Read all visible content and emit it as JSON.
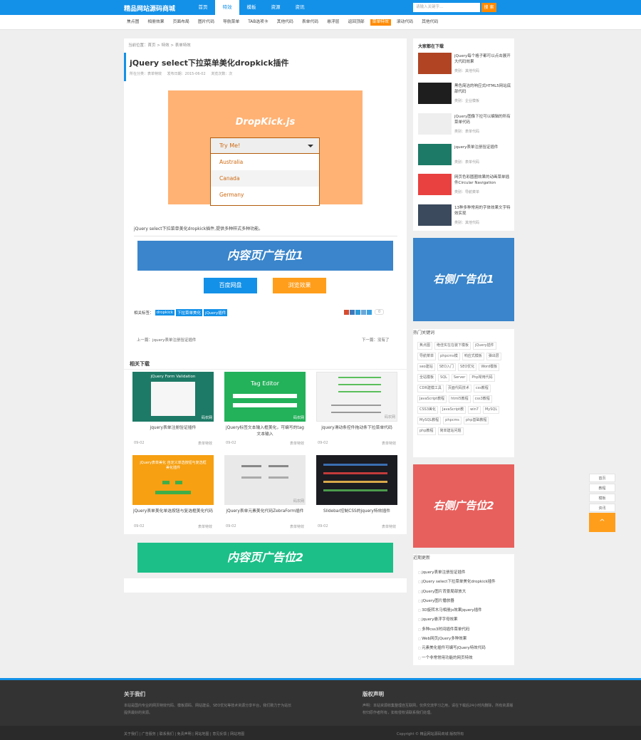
{
  "header": {
    "logo": "精品网站源码商城",
    "nav": [
      "首页",
      "特效",
      "模板",
      "资源",
      "资讯"
    ],
    "active_nav": 1,
    "search_placeholder": "请输入关键字...",
    "search_button": "搜 索",
    "brand_color": "#1391e8",
    "accent_color": "#ff8a00"
  },
  "subnav": [
    "焦点图",
    "相册效果",
    "页面布局",
    "图片代码",
    "导航菜单",
    "TAB选项卡",
    "其他代码",
    "表单代码",
    "悬浮层",
    "返回顶部",
    "菜单特效",
    "滚动代码",
    "其他代码"
  ],
  "subnav_hot_index": 10,
  "article": {
    "breadcrumb": "当前位置：首页 > 特效 > 表单特效",
    "title": "jQuery select下拉菜单美化dropkick插件",
    "meta_category": "所在分类：表单特效",
    "meta_date": "发布日期：2015-06-02",
    "meta_views": "浏览次数：次",
    "preview_title": "DropKick.js",
    "preview_select": "Try Me!",
    "preview_options": [
      "Australia",
      "Canada",
      "Germany"
    ],
    "intro": "jQuery select下拉菜单美化dropkick插件,提供多种样式多种功能。",
    "ad1": "内容页广告位1",
    "btn_pan": "百度网盘",
    "btn_demo": "浏览效果",
    "tags_label": "相关标签：",
    "tags": [
      "dropkick",
      "下拉菜单美化",
      "jQuery插件"
    ],
    "share_count": "0"
  },
  "prevnext": {
    "prev": "上一篇：jquery表单注册验证插件",
    "next": "下一篇：没有了"
  },
  "related": {
    "heading": "相关下载",
    "items": [
      {
        "title": "jquery表单注册验证插件",
        "date": "09-02",
        "cat": "表单特效",
        "thumb_label": "jQuery Form Validation",
        "color": "#1d7a66",
        "watermark": "码农网"
      },
      {
        "title": "jQuery标签文本输入框美化，可编写的tag文本输入",
        "date": "09-02",
        "cat": "表单特效",
        "thumb_label": "Tag Editor",
        "color": "#23b15a",
        "watermark": "码农网"
      },
      {
        "title": "jquery滑动条控件拖动条下拉菜单代码",
        "date": "09-02",
        "cat": "表单特效",
        "thumb_label": "",
        "color": "#f2f2f2",
        "watermark": "码农网"
      },
      {
        "title": "jQuery表单美化单选按钮与复选框美化代码",
        "date": "09-02",
        "cat": "表单特效",
        "thumb_label": "jQuery表单美化 自定义单选按钮与复选框美化插件",
        "color": "#f6a012",
        "watermark": ""
      },
      {
        "title": "jQuery表单元素美化代码ZebraForm插件",
        "date": "09-02",
        "cat": "表单特效",
        "thumb_label": "",
        "color": "#e9e9e9",
        "watermark": "码农网"
      },
      {
        "title": "Slidebar控制CSS的jquery特效插件",
        "date": "09-02",
        "cat": "表单特效",
        "thumb_label": "",
        "color": "#1b1b22",
        "watermark": ""
      }
    ]
  },
  "ad2": "内容页广告位2",
  "sidebar": {
    "popular_heading": "大家都在下载",
    "popular": [
      {
        "title": "jQuery每个格子都可以点击展开大代码效果",
        "cat": "类别：其他代码",
        "color": "#b04423"
      },
      {
        "title": "黑色简洁的响应式HTML5网站底部代码",
        "cat": "类别：企业模板",
        "color": "#1e1e1e"
      },
      {
        "title": "jQuery图像下拉可以编辑的所有菜单代码",
        "cat": "类别：表单代码",
        "color": "#eeeeee"
      },
      {
        "title": "jquery表单注册验证插件",
        "cat": "类别：表单代码",
        "color": "#1d7a66"
      },
      {
        "title": "网页色彩圆圈效果的动画菜单插件Circular Navigation",
        "cat": "类别：导航菜单",
        "color": "#e8413f"
      },
      {
        "title": "13种多种常用的字体效果文字特效实现",
        "cat": "类别：其他代码",
        "color": "#3b4a5d"
      }
    ],
    "ad1": "右侧广告位1",
    "ad1_color": "#3a85cb",
    "hot_heading": "热门关键词",
    "hotwords": [
      "焦点图",
      "绝佳实在在装下模板",
      "jQuery插件",
      "导航菜单",
      "phpcms模",
      "响应式模板",
      "弹出层",
      "seo建站",
      "SEO入门",
      "SEO优化",
      "Word模板",
      "全站模板",
      "SQL",
      "Server",
      "Php常用代码",
      "CDR建模工具",
      "页面代码技术",
      "css教程",
      "JavaScript教程",
      "html5教程",
      "css3教程",
      "CSS3美化",
      "JavaScript教",
      "win7",
      "MySQL",
      "MySQL教程",
      "phpcms",
      "php基础教程",
      "php教程",
      "简单建站问题"
    ],
    "ad2": "右侧广告位2",
    "ad2_color": "#e7605d",
    "latest_heading": "近期更新",
    "latest": [
      "jquery表单注册验证插件",
      "jQuery select下拉菜单美化dropkick插件",
      "jQuery图片背景局部放大",
      "jQuery图片播放器",
      "3D旋转木马相册js效果jquery插件",
      "jquery悬浮字母效果",
      "多种css3时间插件菜单代码",
      "Web网页jQuery多种效果",
      "元素美化插件可编写jQuery特效代码",
      "一个非常常用功能的网页特效"
    ]
  },
  "float": {
    "items": [
      "首页",
      "教程",
      "模板",
      "资讯"
    ],
    "top_icon": "^"
  },
  "footer": {
    "about_heading": "关于我们",
    "about_text": "本站是国内专业的网页特效代码、模板源码、网站建设、SEO优化等技术资源分享平台，我们致力于为站长提供最好的资源。",
    "copyright_heading": "版权声明",
    "copyright_text": "声明：本站资源收集整理自互联网，仅供交流学习之用，请在下载后24小时内删除，所有资源版权归原作者所有，如有侵权请联系我们处理。",
    "links": "关于我们 | 广告服务 | 联系我们 | 免责声明 | 网站地图 | 意见反馈 | 网站地图",
    "copy": "Copyright © 精品网站源码商城 版权所有"
  }
}
